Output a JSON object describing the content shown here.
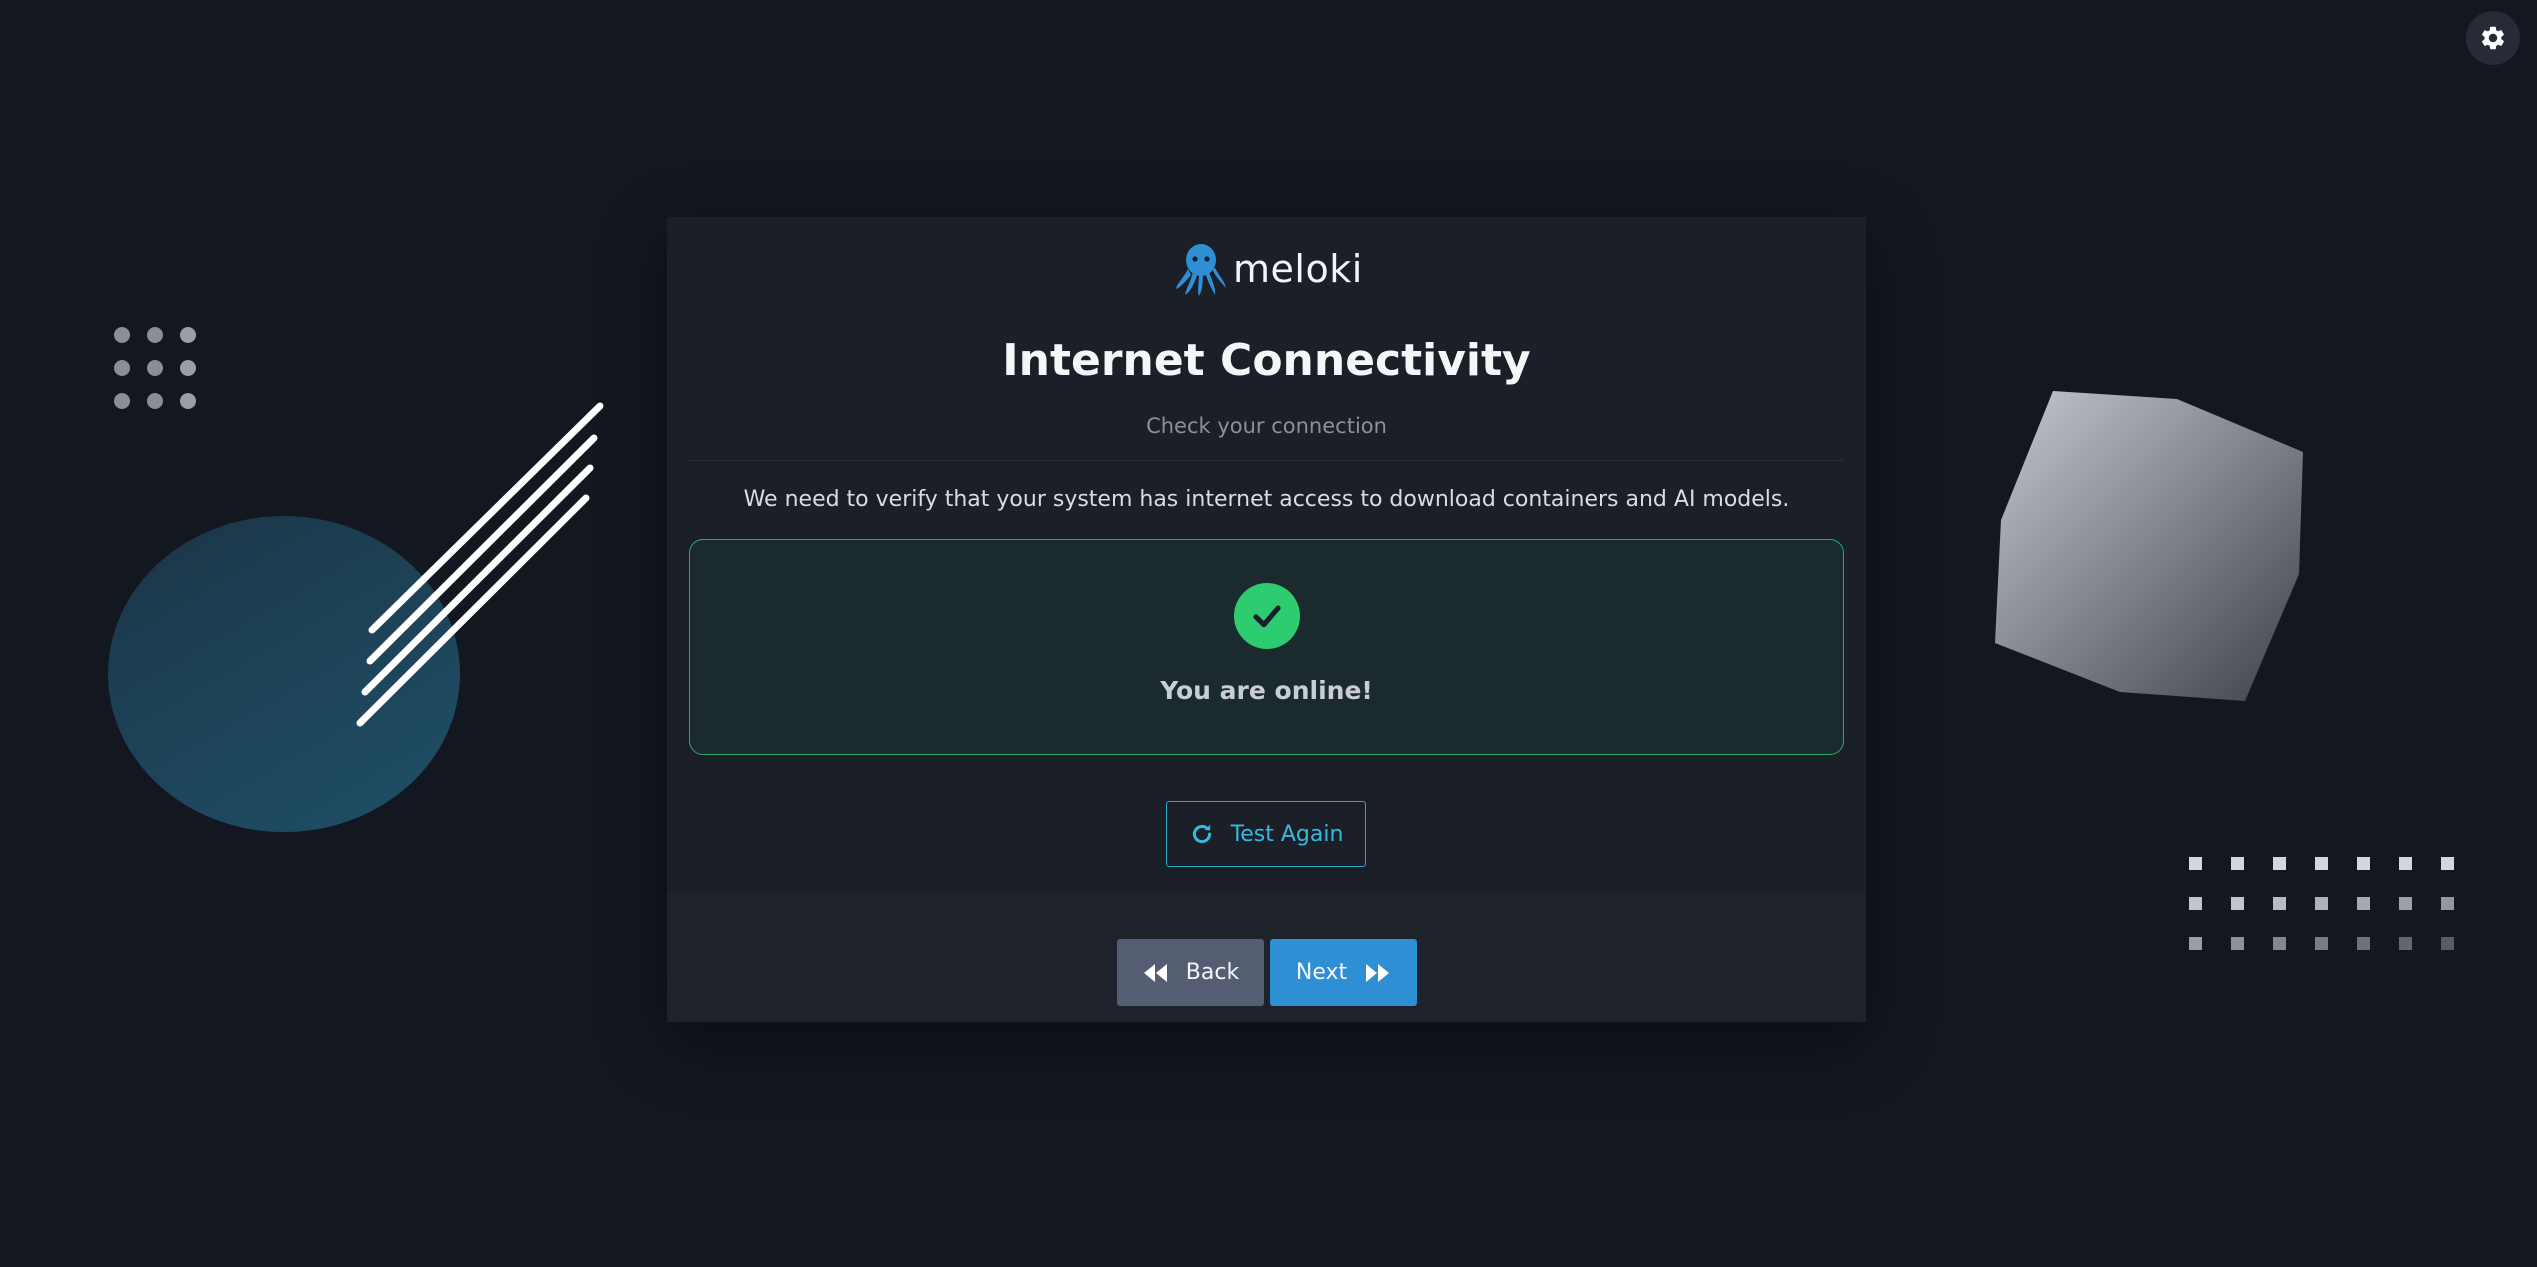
{
  "app": {
    "brand_name": "meloki",
    "logo_icon": "octopus-icon",
    "settings_icon": "gear-icon"
  },
  "wizard": {
    "title": "Internet Connectivity",
    "subtitle": "Check your connection",
    "description": "We need to verify that your system has internet access to download containers and AI models."
  },
  "status": {
    "state": "online",
    "icon": "check-icon",
    "message": "You are online!",
    "color": "#2ecc71"
  },
  "actions": {
    "test_again_label": "Test Again",
    "test_again_icon": "refresh-icon",
    "back_label": "Back",
    "back_icon": "rewind-icon",
    "next_label": "Next",
    "next_icon": "fast-forward-icon"
  },
  "colors": {
    "background": "#13171f",
    "card": "#1b1f27",
    "accent": "#2f8fd4",
    "secondary_button": "#545d72",
    "success": "#2ecc71",
    "link": "#39b8de"
  }
}
